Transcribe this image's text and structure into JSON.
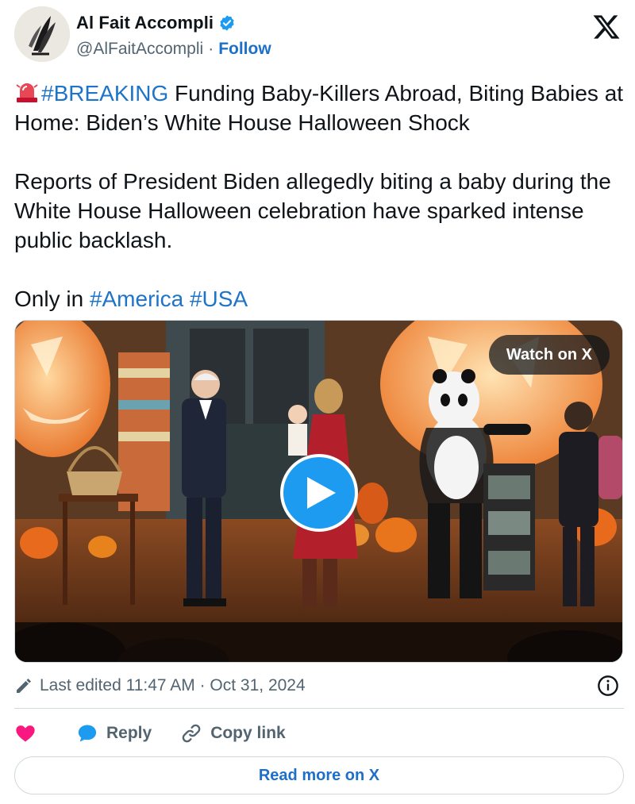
{
  "author": {
    "name": "Al Fait Accompli",
    "handle": "@AlFaitAccompli",
    "separator": "·",
    "follow_label": "Follow"
  },
  "tweet": {
    "breaking_tag": "#BREAKING",
    "headline_rest": " Funding Baby-Killers Abroad, Biting Babies at Home: Biden’s White House Halloween Shock",
    "body": "Reports of President Biden allegedly biting a baby during the White House Halloween celebration have sparked intense public backlash.",
    "closing_prefix": "Only in ",
    "hashtags": [
      "#America",
      "#USA"
    ]
  },
  "media": {
    "watch_label": "Watch on X"
  },
  "meta": {
    "edited_text": "Last edited 11:47 AM · Oct 31, 2024"
  },
  "actions": {
    "reply_label": "Reply",
    "copy_label": "Copy link"
  },
  "read_more_label": "Read more on X",
  "colors": {
    "link_blue": "#1d74c8",
    "play_blue": "#1d9bf0",
    "heart_pink": "#f91880",
    "text": "#0f1419",
    "muted": "#536471"
  },
  "icons": [
    "verified-badge-icon",
    "x-logo-icon",
    "siren-emoji-icon",
    "play-icon",
    "pencil-icon",
    "info-icon",
    "heart-icon",
    "reply-bubble-icon",
    "link-icon"
  ]
}
